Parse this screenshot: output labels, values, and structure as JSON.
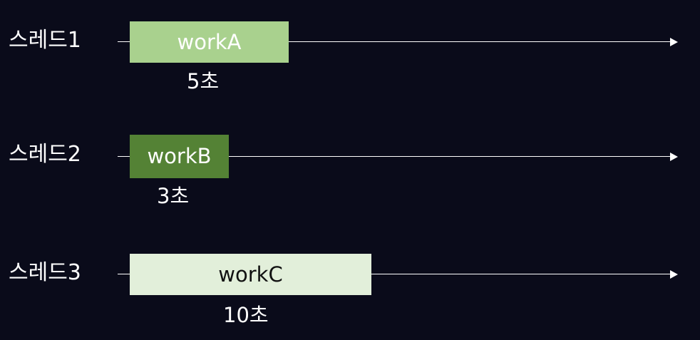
{
  "threads": [
    {
      "label": "스레드1",
      "work": "workA",
      "duration": "5초",
      "seconds": 5,
      "color": "#a9d18e"
    },
    {
      "label": "스레드2",
      "work": "workB",
      "duration": "3초",
      "seconds": 3,
      "color": "#548235"
    },
    {
      "label": "스레드3",
      "work": "workC",
      "duration": "10초",
      "seconds": 10,
      "color": "#e2efda"
    }
  ]
}
